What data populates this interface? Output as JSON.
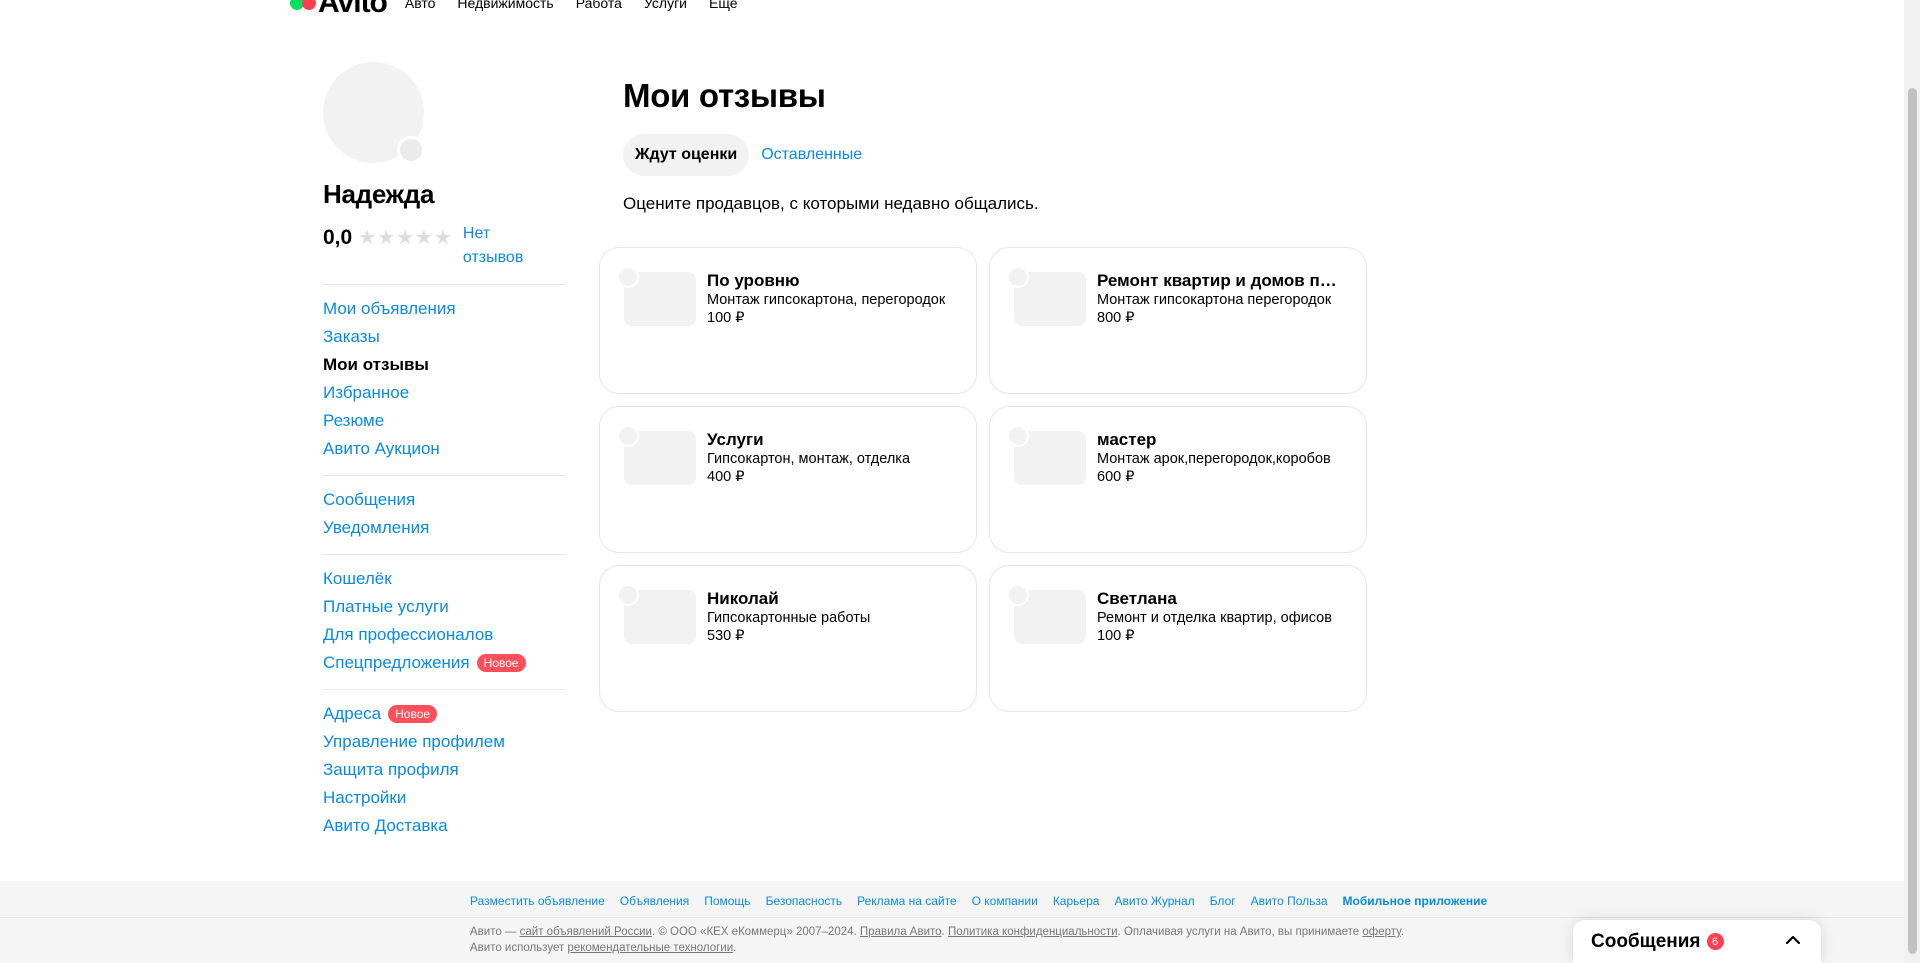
{
  "logo": {
    "text": "Avito"
  },
  "topnav": {
    "items": [
      "Авто",
      "Недвижимость",
      "Работа",
      "Услуги",
      "Еще"
    ]
  },
  "profile": {
    "name": "Надежда",
    "rating": "0,0",
    "stars_filled": 0,
    "stars_total": 5,
    "no_reviews": "Нет отзывов"
  },
  "sidebar": {
    "groups": [
      [
        {
          "label": "Мои объявления"
        },
        {
          "label": "Заказы"
        },
        {
          "label": "Мои отзывы",
          "active": true
        },
        {
          "label": "Избранное"
        },
        {
          "label": "Резюме"
        },
        {
          "label": "Авито Аукцион"
        }
      ],
      [
        {
          "label": "Сообщения"
        },
        {
          "label": "Уведомления"
        }
      ],
      [
        {
          "label": "Кошелёк"
        },
        {
          "label": "Платные услуги"
        },
        {
          "label": "Для профессионалов"
        },
        {
          "label": "Спецпредложения",
          "badge": "Новое"
        }
      ],
      [
        {
          "label": "Адреса",
          "badge": "Новое"
        },
        {
          "label": "Управление профилем"
        },
        {
          "label": "Защита профиля"
        },
        {
          "label": "Настройки"
        },
        {
          "label": "Авито Доставка"
        }
      ]
    ]
  },
  "main": {
    "title": "Мои отзывы",
    "tabs": [
      {
        "label": "Ждут оценки",
        "active": true
      },
      {
        "label": "Оставленные",
        "active": false
      }
    ],
    "hint": "Оцените продавцов, с которыми недавно общались.",
    "cards": [
      {
        "name": "По уровню",
        "desc": "Монтаж гипсокартона, перегородок",
        "price": "100 ₽"
      },
      {
        "name": "Ремонт квартир и домов под ключ",
        "desc": "Монтаж гипсокартона перегородок",
        "price": "800 ₽"
      },
      {
        "name": "Услуги",
        "desc": "Гипсокартон, монтаж, отделка",
        "price": "400 ₽"
      },
      {
        "name": "мастер",
        "desc": "Монтаж арок,перегородок,коробов",
        "price": "600 ₽"
      },
      {
        "name": "Николай",
        "desc": "Гипсокартонные работы",
        "price": "530 ₽"
      },
      {
        "name": "Светлана",
        "desc": "Ремонт и отделка квартир, офисов",
        "price": "100 ₽"
      }
    ]
  },
  "footer": {
    "links": [
      {
        "label": "Разместить объявление"
      },
      {
        "label": "Объявления"
      },
      {
        "label": "Помощь"
      },
      {
        "label": "Безопасность"
      },
      {
        "label": "Реклама на сайте"
      },
      {
        "label": "О компании"
      },
      {
        "label": "Карьера"
      },
      {
        "label": "Авито Журнал"
      },
      {
        "label": "Блог"
      },
      {
        "label": "Авито Польза"
      },
      {
        "label": "Мобильное приложение",
        "bold": true
      }
    ],
    "legal": {
      "p1": "Авито — ",
      "link1": "сайт объявлений России",
      "p2": ". © ООО «КЕХ еКоммерц» 2007–2024. ",
      "link2": "Правила Авито",
      "p3": ". ",
      "link3": "Политика конфиденциальности",
      "p4": ". Оплачивая услуги на Авито, вы принимаете ",
      "link4": "оферту",
      "p5": ". Авито использует ",
      "link5": "рекомендательные технологии",
      "p6": "."
    }
  },
  "messenger": {
    "title": "Сообщения",
    "count": "6"
  },
  "colors": {
    "link": "#0a8ae0",
    "badge": "#ff4f5a",
    "logo_green": "#04e061",
    "logo_red": "#ff4053"
  }
}
